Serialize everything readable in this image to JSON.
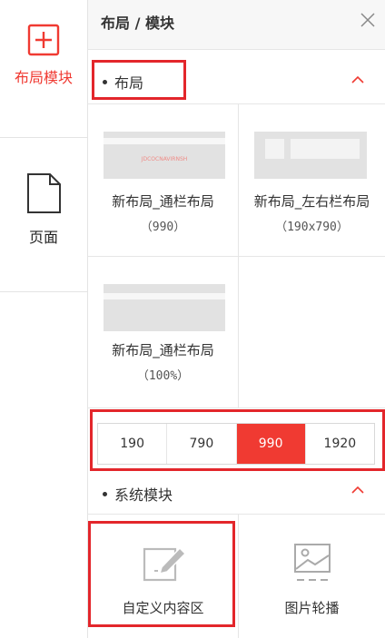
{
  "rail": {
    "items": [
      {
        "label": "布局模块",
        "icon": "plus-square-icon",
        "active": true
      },
      {
        "label": "页面",
        "icon": "page-icon",
        "active": false
      }
    ]
  },
  "panel": {
    "title": "布局 / 模块",
    "close_icon": "close-icon"
  },
  "layout_section": {
    "title": "布局",
    "layouts": [
      {
        "name": "新布局_通栏布局",
        "size": "（990）"
      },
      {
        "name": "新布局_左右栏布局",
        "size": "（190x790）"
      },
      {
        "name": "新布局_通栏布局",
        "size": "（100%）"
      }
    ],
    "thumb_tag": "JDCOCNAVIRNSH"
  },
  "width_selector": {
    "options": [
      "190",
      "790",
      "990",
      "1920"
    ],
    "selected": "990"
  },
  "modules_section": {
    "title": "系统模块",
    "modules": [
      {
        "label": "自定义内容区",
        "icon": "edit-content-icon"
      },
      {
        "label": "图片轮播",
        "icon": "image-carousel-icon"
      }
    ]
  },
  "colors": {
    "accent": "#f03a32",
    "highlight": "#e3262b",
    "border": "#e6e6e6"
  }
}
